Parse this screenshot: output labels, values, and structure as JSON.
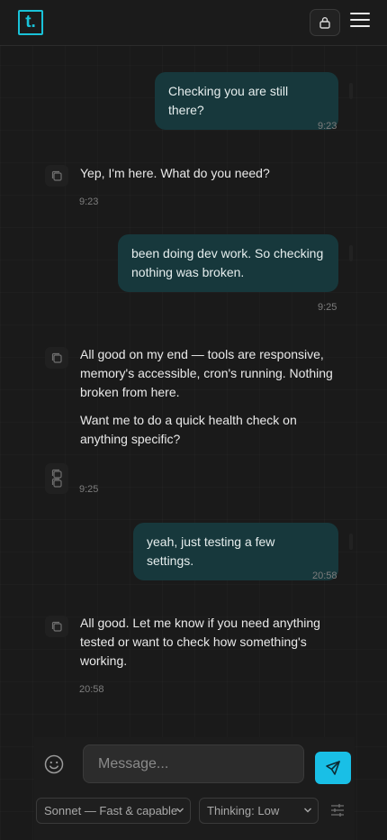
{
  "header": {
    "logo_text": "t.",
    "lock_icon": "lock-icon",
    "menu_icon": "hamburger-menu-icon"
  },
  "messages": [
    {
      "role": "user",
      "text": "Checking you are still there?",
      "time": "9:23"
    },
    {
      "role": "assistant",
      "paragraphs": [
        "Yep, I'm here. What do you need?"
      ],
      "time": "9:23"
    },
    {
      "role": "user",
      "lines": [
        "been doing dev work. So checking",
        "nothing was broken."
      ],
      "time": "9:25"
    },
    {
      "role": "assistant",
      "paragraphs": [
        "All good on my end — tools are responsive, memory's accessible, cron's running. Nothing broken from here.",
        "Want me to do a quick health check on anything specific?"
      ],
      "time": "9:25"
    },
    {
      "role": "user",
      "text": "yeah, just testing a few settings.",
      "time": "20:58"
    },
    {
      "role": "assistant",
      "paragraphs": [
        "All good. Let me know if you need anything tested or want to check how something's working."
      ],
      "time": "20:58"
    }
  ],
  "composer": {
    "placeholder": "Message...",
    "model_select": "Sonnet — Fast & capable",
    "thinking_select": "Thinking: Low",
    "send_icon": "send-icon",
    "emoji_icon": "emoji-icon",
    "settings_icon": "sliders-icon"
  },
  "colors": {
    "accent": "#19bfe6",
    "user_bubble": "#17383c",
    "background": "#1a1a1a"
  }
}
